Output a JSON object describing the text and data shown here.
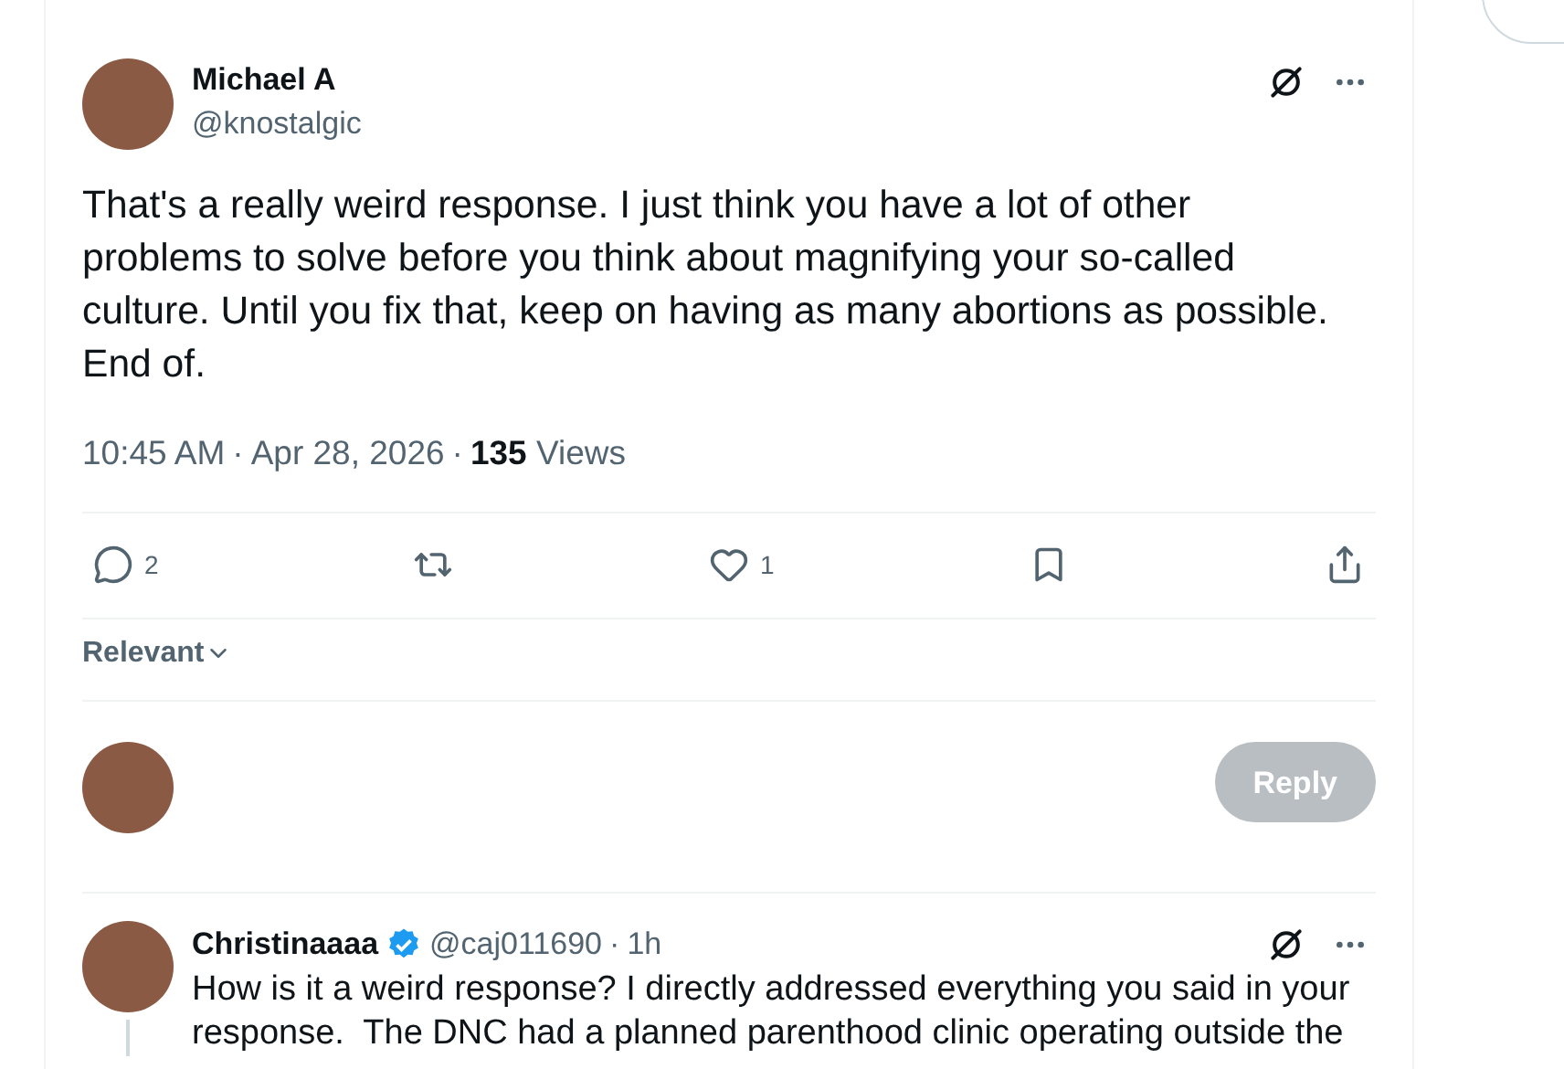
{
  "post": {
    "author": {
      "name": "Michael A",
      "handle": "@knostalgic"
    },
    "text": "That's a really weird response. I just think you have a lot of other problems to solve before you think about magnifying your so-called culture. Until you fix that, keep on having as many abortions as possible. End of.",
    "time": "10:45 AM",
    "separator": "·",
    "date": "Apr 28, 2026",
    "views_count": "135",
    "views_label": "Views",
    "actions": [
      {
        "kind": "reply",
        "count": "2"
      },
      {
        "kind": "repost"
      },
      {
        "kind": "like",
        "count": "1"
      },
      {
        "kind": "bookmark"
      },
      {
        "kind": "share"
      }
    ]
  },
  "sort": {
    "label": "Relevant"
  },
  "composer": {
    "button": "Reply",
    "disabled": true
  },
  "replies": [
    {
      "name": "Christinaaaa",
      "verified": true,
      "handle": "@caj011690",
      "separator": "·",
      "age": "1h",
      "text": "How is it a weird response? I directly addressed everything you said in your response.  The DNC had a planned parenthood clinic operating outside the"
    }
  ]
}
